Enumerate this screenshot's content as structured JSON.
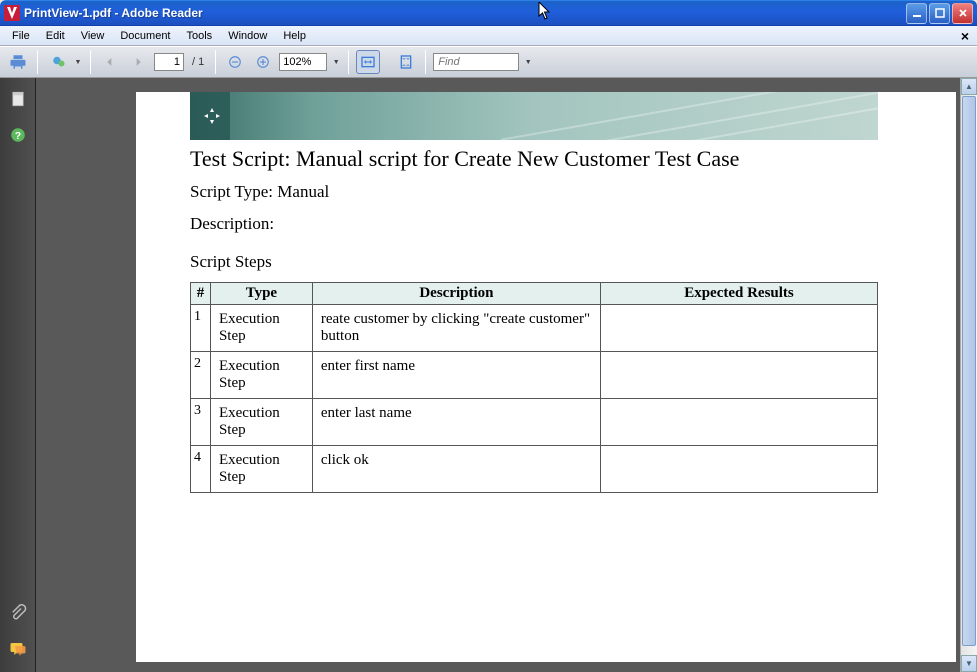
{
  "window": {
    "title": "PrintView-1.pdf - Adobe Reader"
  },
  "menu": {
    "items": [
      "File",
      "Edit",
      "View",
      "Document",
      "Tools",
      "Window",
      "Help"
    ],
    "close_doc": "×"
  },
  "toolbar": {
    "page_current": "1",
    "page_total": "/ 1",
    "zoom": "102%",
    "find_placeholder": "Find"
  },
  "document": {
    "heading": "Test Script: Manual script for Create New Customer Test Case",
    "script_type_label": "Script Type:",
    "script_type_value": "Manual",
    "description_label": "Description:",
    "description_value": "",
    "steps_heading": "Script Steps",
    "columns": {
      "num": "#",
      "type": "Type",
      "description": "Description",
      "expected": "Expected Results"
    },
    "rows": [
      {
        "num": "1",
        "type": "Execution Step",
        "description": "reate customer by clicking \"create customer\" button",
        "expected": ""
      },
      {
        "num": "2",
        "type": "Execution Step",
        "description": "enter first name",
        "expected": ""
      },
      {
        "num": "3",
        "type": "Execution Step",
        "description": "enter last name",
        "expected": ""
      },
      {
        "num": "4",
        "type": "Execution Step",
        "description": "click ok",
        "expected": ""
      }
    ]
  }
}
